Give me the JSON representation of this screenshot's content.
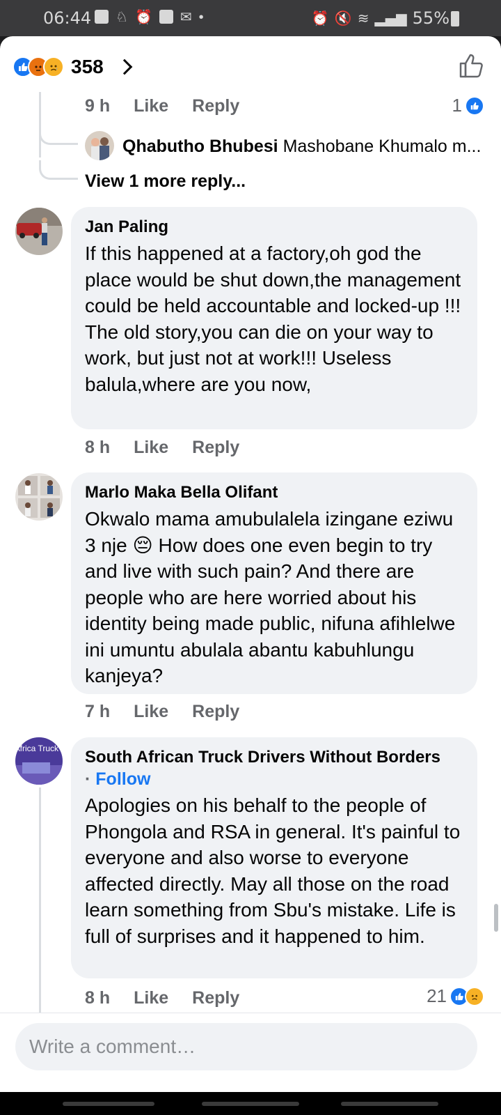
{
  "status_bar": {
    "time": "06:44",
    "battery": "55%",
    "battery_small": "7"
  },
  "header": {
    "reaction_count": "358",
    "reactions": [
      "like-icon",
      "angry-icon",
      "sad-icon"
    ]
  },
  "prev_comment": {
    "time": "9 h",
    "like_label": "Like",
    "reply_label": "Reply",
    "reaction_count": "1",
    "reply_preview_name": "Qhabutho Bhubesi",
    "reply_preview_text": "Mashobane Khumalo m...",
    "view_more": "View 1 more reply..."
  },
  "comments": [
    {
      "author": "Jan Paling",
      "text": "If this happened at a factory,oh god the place would be shut down,the management could be held accountable and locked-up !!! The old story,you can die on your way to work, but just not at work!!! Useless balula,where are you now,",
      "time": "8 h",
      "like_label": "Like",
      "reply_label": "Reply"
    },
    {
      "author": "Marlo Maka Bella Olifant",
      "text_part1": "Okwalo mama amubulalela izingane eziwu 3 nje",
      "emoji": "😔",
      "text_part2": "How does one even begin to try and live with such pain? And there are people who are here worried about his identity being made public, nifuna afihlelwe ini umuntu abulala abantu kabuhlungu kanjeya?",
      "time": "7 h",
      "like_label": "Like",
      "reply_label": "Reply"
    },
    {
      "author": "South African Truck Drivers Without Borders",
      "follow_dot": "·",
      "follow_label": "Follow",
      "avatar_text": "South Africa Truck Drivers",
      "text": "Apologies on his behalf to the people of Phongola and RSA in general. It's painful to everyone and also worse to everyone affected directly. May all those on the road learn something from Sbu's mistake. Life is full of surprises and it happened to him.",
      "time": "8 h",
      "like_label": "Like",
      "reply_label": "Reply",
      "reaction_count": "21"
    }
  ],
  "composer": {
    "placeholder": "Write a comment…"
  },
  "colors": {
    "facebook_blue": "#1877f2",
    "bubble_bg": "#f0f2f5",
    "secondary_text": "#65676b"
  }
}
